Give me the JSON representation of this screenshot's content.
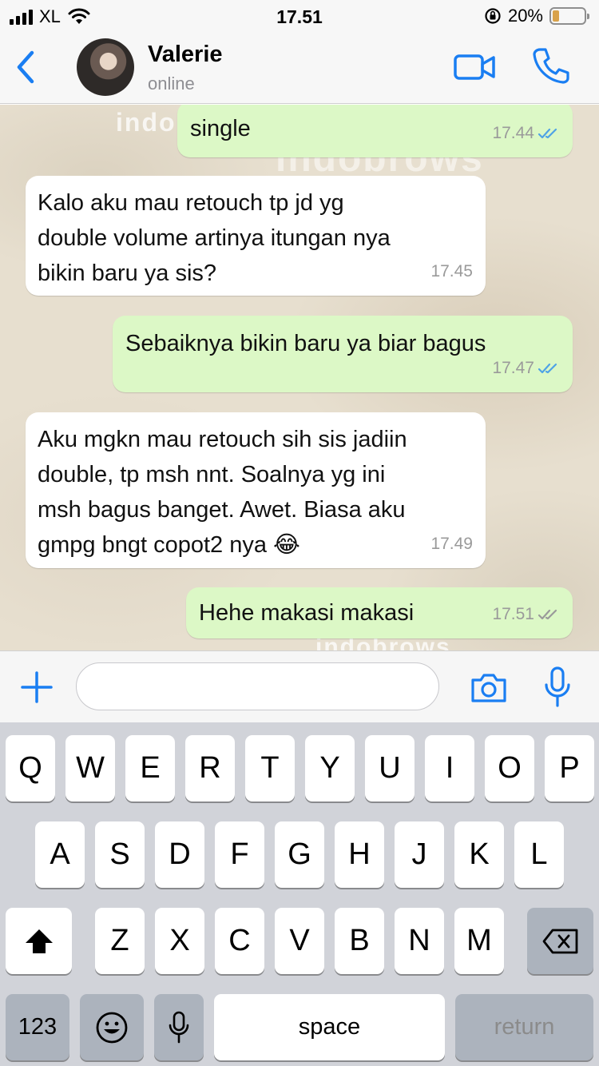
{
  "status_bar": {
    "carrier": "XL",
    "time": "17.51",
    "battery_percent": "20%",
    "battery_level": 0.2,
    "icons": [
      "signal-icon",
      "wifi-icon",
      "orientation-lock-icon",
      "battery-icon"
    ]
  },
  "header": {
    "back_icon": "chevron-left-icon",
    "contact_name": "Valerie",
    "contact_status": "online",
    "video_icon": "video-camera-icon",
    "call_icon": "phone-icon"
  },
  "chat": {
    "watermark": "indobrows",
    "messages": [
      {
        "direction": "out",
        "text": "single",
        "time": "17.44",
        "read": true
      },
      {
        "direction": "in",
        "text": "Kalo aku mau retouch tp jd yg\ndouble volume artinya itungan nya\nbikin baru ya sis?",
        "time": "17.45"
      },
      {
        "direction": "out",
        "text": "Sebaiknya bikin baru ya biar bagus",
        "time": "17.47",
        "read": true
      },
      {
        "direction": "in",
        "text": "Aku mgkn mau retouch sih sis jadiin\ndouble, tp msh nnt. Soalnya yg ini\nmsh bagus banget. Awet. Biasa aku\ngmpg bngt copot2 nya 😂",
        "time": "17.49"
      },
      {
        "direction": "out",
        "text": "Hehe makasi makasi",
        "time": "17.51",
        "read": false
      }
    ]
  },
  "input_bar": {
    "add_icon": "plus-icon",
    "placeholder": "",
    "value": "",
    "camera_icon": "camera-icon",
    "mic_icon": "microphone-icon"
  },
  "keyboard": {
    "row1": [
      "Q",
      "W",
      "E",
      "R",
      "T",
      "Y",
      "U",
      "I",
      "O",
      "P"
    ],
    "row2": [
      "A",
      "S",
      "D",
      "F",
      "G",
      "H",
      "J",
      "K",
      "L"
    ],
    "row3": [
      "Z",
      "X",
      "C",
      "V",
      "B",
      "N",
      "M"
    ],
    "numbers_key": "123",
    "space_key": "space",
    "return_key": "return",
    "shift_icon": "shift-icon",
    "backspace_icon": "backspace-icon",
    "emoji_icon": "emoji-icon",
    "dictation_icon": "microphone-icon"
  },
  "colors": {
    "accent": "#1a7ef2",
    "outgoing_bubble": "#dcf8c6",
    "incoming_bubble": "#ffffff",
    "read_tick": "#4fa3e6",
    "keyboard_bg": "#d1d3d9"
  }
}
